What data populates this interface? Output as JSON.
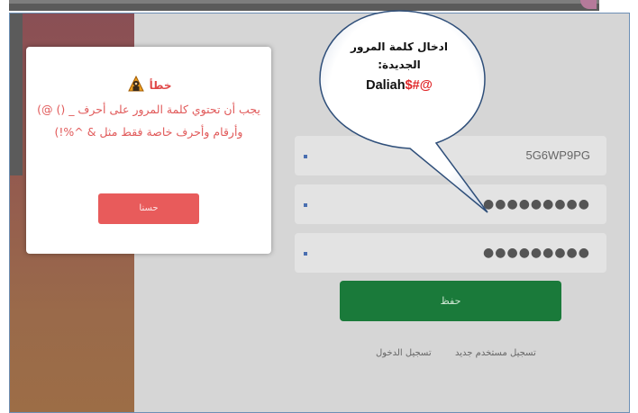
{
  "dialog": {
    "title": "خطأ",
    "message": "يجب أن تحتوي كلمة المرور على أحرف _ () @) وأرقام وأحرف خاصة فقط مثل & ^%!)",
    "ok_label": "حسنا",
    "icon": "warning-person-icon"
  },
  "form": {
    "username_value": "5G6WP9PG",
    "password_value": "●●●●●●●●●",
    "confirm_password_value": "●●●●●●●●●",
    "save_label": "حفظ",
    "register_link": "تسجيل مستخدم جديد",
    "login_link": "تسجيل الدخول"
  },
  "callout": {
    "line1": "ادخال كلمة المرور",
    "line2": "الجديدة:",
    "password_plain": "Daliah",
    "password_symbols": "$#@"
  },
  "colors": {
    "error_red": "#e04848",
    "save_green": "#1a7a3a",
    "dialog_button": "#e85b5b"
  }
}
